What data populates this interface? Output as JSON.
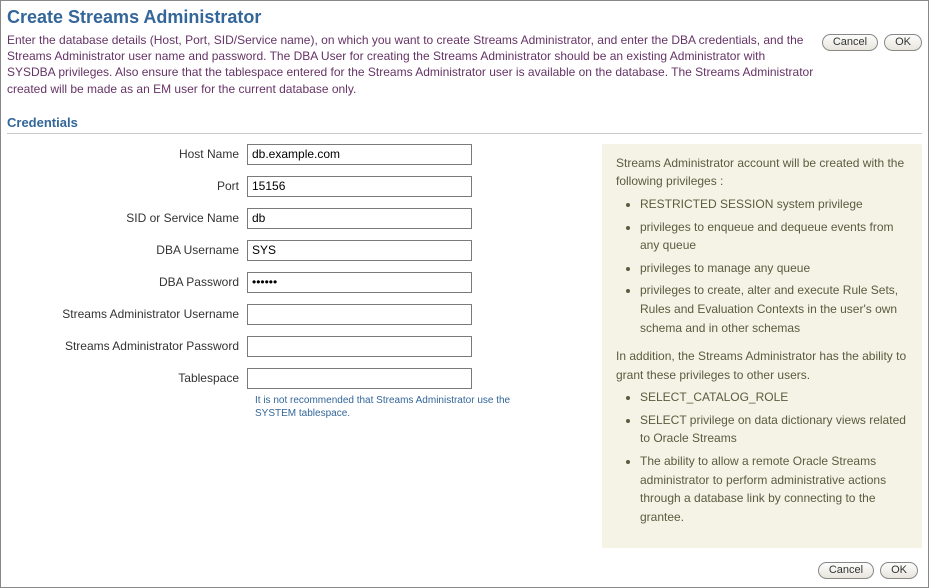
{
  "page": {
    "title": "Create Streams Administrator",
    "intro": "Enter the database details (Host, Port, SID/Service name), on which you want to create Streams Administrator, and enter the DBA credentials, and the Streams Administrator user name and password. The DBA User for creating the Streams Administrator should be an existing Administrator with SYSDBA privileges. Also ensure that the tablespace entered for the Streams Administrator user is available on the database. The Streams Administrator created will be made as an EM user for the current database only."
  },
  "buttons": {
    "cancel": "Cancel",
    "ok": "OK"
  },
  "credentials": {
    "section_title": "Credentials",
    "host_label": "Host Name",
    "host_value": "db.example.com",
    "port_label": "Port",
    "port_value": "15156",
    "sid_label": "SID or Service Name",
    "sid_value": "db",
    "dba_user_label": "DBA Username",
    "dba_user_value": "SYS",
    "dba_pass_label": "DBA Password",
    "dba_pass_value": "••••••",
    "strm_user_label": "Streams Administrator Username",
    "strm_user_value": "",
    "strm_pass_label": "Streams Administrator Password",
    "strm_pass_value": "",
    "ts_label": "Tablespace",
    "ts_value": "",
    "ts_hint": "It is not recommended that Streams Administrator use the SYSTEM tablespace."
  },
  "info": {
    "lead": "Streams Administrator account will be created with the following privileges :",
    "privs": [
      "RESTRICTED SESSION system privilege",
      "privileges to enqueue and dequeue events from any queue",
      "privileges to manage any queue",
      "privileges to create, alter and execute Rule Sets, Rules and Evaluation Contexts in the user's own schema and in other schemas"
    ],
    "addendum": "In addition, the Streams Administrator has the ability to grant these privileges to other users.",
    "extra": [
      "SELECT_CATALOG_ROLE",
      "SELECT privilege on data dictionary views related to Oracle Streams",
      "The ability to allow a remote Oracle Streams administrator to perform administrative actions through a database link by connecting to the grantee."
    ]
  }
}
